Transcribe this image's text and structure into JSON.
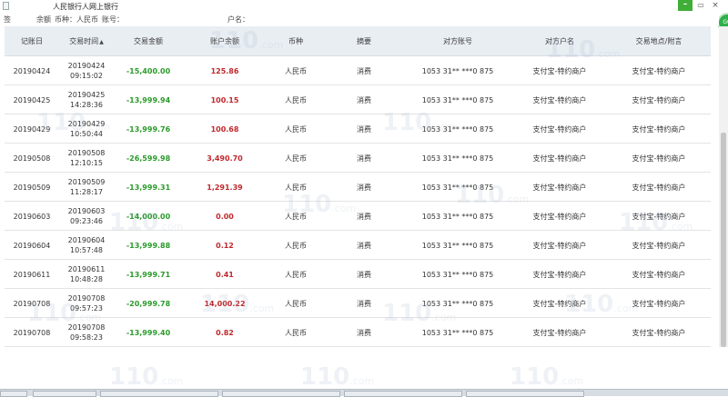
{
  "window": {
    "title": "人民银行人网上银行",
    "minimize_label": "–",
    "restore_label": "▭",
    "close_label": "×"
  },
  "info_bar": {
    "segments": [
      "签",
      "余额",
      "币种：人民币",
      "账号：",
      "户名："
    ]
  },
  "table": {
    "headers": [
      "记账日",
      "交易时间",
      "交易金额",
      "账户余额",
      "币种",
      "摘要",
      "对方账号",
      "对方户名",
      "交易地点/附言"
    ],
    "rows": [
      {
        "date": "20190424",
        "time_date": "20190424",
        "time_clock": "09:15:02",
        "amount": "-15,400.00",
        "balance": "125.86",
        "currency": "人民币",
        "summary": "消费",
        "account": "1053 31** ***0 875",
        "name": "支付宝-特约商户",
        "place": "支付宝-特约商户"
      },
      {
        "date": "20190425",
        "time_date": "20190425",
        "time_clock": "14:28:36",
        "amount": "-13,999.94",
        "balance": "100.15",
        "currency": "人民币",
        "summary": "消费",
        "account": "1053 31** ***0 875",
        "name": "支付宝-特约商户",
        "place": "支付宝-特约商户"
      },
      {
        "date": "20190429",
        "time_date": "20190429",
        "time_clock": "10:50:44",
        "amount": "-13,999.76",
        "balance": "100.68",
        "currency": "人民币",
        "summary": "消费",
        "account": "1053 31** ***0 875",
        "name": "支付宝-特约商户",
        "place": "支付宝-特约商户"
      },
      {
        "date": "20190508",
        "time_date": "20190508",
        "time_clock": "12:10:15",
        "amount": "-26,599.98",
        "balance": "3,490.70",
        "currency": "人民币",
        "summary": "消费",
        "account": "1053 31** ***0 875",
        "name": "支付宝-特约商户",
        "place": "支付宝-特约商户"
      },
      {
        "date": "20190509",
        "time_date": "20190509",
        "time_clock": "11:28:17",
        "amount": "-13,999.31",
        "balance": "1,291.39",
        "currency": "人民币",
        "summary": "消费",
        "account": "1053 31** ***0 875",
        "name": "支付宝-特约商户",
        "place": "支付宝-特约商户"
      },
      {
        "date": "20190603",
        "time_date": "20190603",
        "time_clock": "09:23:46",
        "amount": "-14,000.00",
        "balance": "0.00",
        "currency": "人民币",
        "summary": "消费",
        "account": "1053 31** ***0 875",
        "name": "支付宝-特约商户",
        "place": "支付宝-特约商户"
      },
      {
        "date": "20190604",
        "time_date": "20190604",
        "time_clock": "10:57:48",
        "amount": "-13,999.88",
        "balance": "0.12",
        "currency": "人民币",
        "summary": "消费",
        "account": "1053 31** ***0 875",
        "name": "支付宝-特约商户",
        "place": "支付宝-特约商户"
      },
      {
        "date": "20190611",
        "time_date": "20190611",
        "time_clock": "10:48:28",
        "amount": "-13,999.71",
        "balance": "0.41",
        "currency": "人民币",
        "summary": "消费",
        "account": "1053 31** ***0 875",
        "name": "支付宝-特约商户",
        "place": "支付宝-特约商户"
      },
      {
        "date": "20190708",
        "time_date": "20190708",
        "time_clock": "09:57:23",
        "amount": "-20,999.78",
        "balance": "14,000.22",
        "currency": "人民币",
        "summary": "消费",
        "account": "1053 31** ***0 875",
        "name": "支付宝-特约商户",
        "place": "支付宝-特约商户"
      },
      {
        "date": "20190708",
        "time_date": "20190708",
        "time_clock": "09:58:23",
        "amount": "-13,999.40",
        "balance": "0.82",
        "currency": "人民币",
        "summary": "消费",
        "account": "1053 31** ***0 875",
        "name": "支付宝-特约商户",
        "place": "支付宝-特约商户"
      }
    ]
  },
  "watermark": {
    "text": "110",
    "suffix": ".com"
  },
  "badge": {
    "label": "GO"
  },
  "colors": {
    "header_bg": "#e9eef3",
    "negative_amount": "#2a9a2a",
    "balance": "#c0282d",
    "minimize_green": "#3fae36"
  }
}
